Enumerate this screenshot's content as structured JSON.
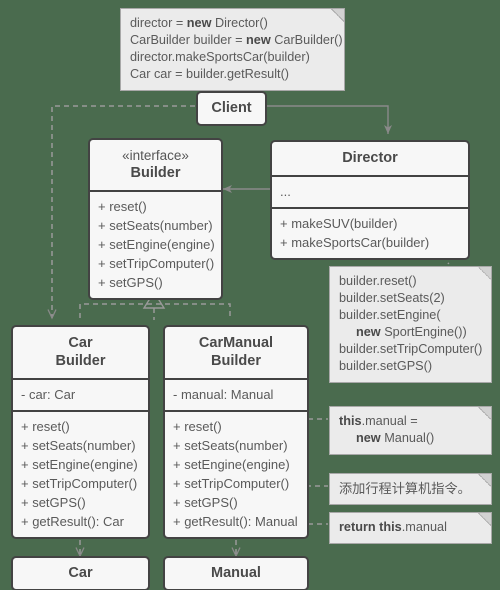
{
  "diagram": {
    "title": "Builder Pattern UML Class Diagram",
    "background_color": "#4a6b4e",
    "box_fill": "#f7f7f7",
    "box_border": "#434343",
    "note_fill": "#ebebeb",
    "note_border": "#a8a8a8",
    "connector_color": "#8a8a8a"
  },
  "client_note": {
    "lines": [
      {
        "pre": "director = ",
        "bold": "new",
        "post": " Director()"
      },
      {
        "pre": "CarBuilder builder = ",
        "bold": "new",
        "post": " CarBuilder()"
      },
      {
        "pre": "director.makeSportsCar(builder)",
        "bold": "",
        "post": ""
      },
      {
        "pre": "Car car = builder.getResult()",
        "bold": "",
        "post": ""
      }
    ]
  },
  "client": {
    "name": "Client"
  },
  "builder_interface": {
    "stereotype": "«interface»",
    "name": "Builder",
    "methods": [
      "+ reset()",
      "+ setSeats(number)",
      "+ setEngine(engine)",
      "+ setTripComputer()",
      "+ setGPS()"
    ]
  },
  "director": {
    "name": "Director",
    "fields": [
      "..."
    ],
    "methods": [
      "+ makeSUV(builder)",
      "+ makeSportsCar(builder)"
    ]
  },
  "director_note": {
    "lines": [
      {
        "pre": "builder.reset()",
        "bold": "",
        "post": "",
        "indent": false
      },
      {
        "pre": "builder.setSeats(2)",
        "bold": "",
        "post": "",
        "indent": false
      },
      {
        "pre": "builder.setEngine(",
        "bold": "",
        "post": "",
        "indent": false
      },
      {
        "pre": "",
        "bold": "new",
        "post": " SportEngine())",
        "indent": true
      },
      {
        "pre": "builder.setTripComputer()",
        "bold": "",
        "post": "",
        "indent": false
      },
      {
        "pre": "builder.setGPS()",
        "bold": "",
        "post": "",
        "indent": false
      }
    ]
  },
  "car_builder": {
    "name_line1": "Car",
    "name_line2": "Builder",
    "fields": [
      "- car: Car"
    ],
    "methods": [
      "+ reset()",
      "+ setSeats(number)",
      "+ setEngine(engine)",
      "+ setTripComputer()",
      "+ setGPS()",
      "+ getResult(): Car"
    ]
  },
  "car_manual_builder": {
    "name_line1": "CarManual",
    "name_line2": "Builder",
    "fields": [
      "- manual: Manual"
    ],
    "methods": [
      "+ reset()",
      "+ setSeats(number)",
      "+ setEngine(engine)",
      "+ setTripComputer()",
      "+ setGPS()",
      "+ getResult(): Manual"
    ]
  },
  "note_reset": {
    "lines": [
      {
        "pre": "",
        "bold": "this",
        "post": ".manual =",
        "indent": false
      },
      {
        "pre": "",
        "bold": "new",
        "post": " Manual()",
        "indent": true
      }
    ]
  },
  "note_trip_computer": {
    "text": "添加行程计算机指令。"
  },
  "note_get_result": {
    "lines": [
      {
        "pre": "",
        "bold": "return this",
        "post": ".manual",
        "indent": false
      }
    ]
  },
  "car_product": {
    "name": "Car"
  },
  "manual_product": {
    "name": "Manual"
  }
}
